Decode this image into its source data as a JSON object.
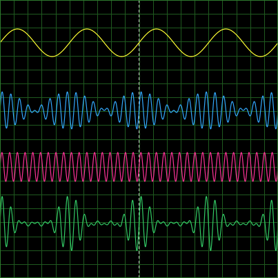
{
  "screen": {
    "background": "#000000",
    "grid_color": "#1f5a1f",
    "border_color": "#2e7a2e",
    "center_marker_color": "#bfbfbf",
    "major_divisions_x": 20,
    "major_divisions_y": 20,
    "center_marker": "dashed"
  },
  "chart_data": {
    "type": "line",
    "title": "",
    "xlabel": "",
    "ylabel": "",
    "grid": true,
    "legend": "none",
    "x_range": [
      0,
      1
    ],
    "traces": [
      {
        "id": "trace-1",
        "color": "#ffff33",
        "kind": "sine",
        "cycles": 4,
        "phase": 0.0,
        "amplitude": 1.0
      },
      {
        "id": "trace-2",
        "color": "#33aaff",
        "kind": "sum-of-sines",
        "components": [
          {
            "cycles": 30,
            "amplitude": 0.5
          },
          {
            "cycles": 34,
            "amplitude": 0.5
          }
        ]
      },
      {
        "id": "trace-3",
        "color": "#ff3399",
        "kind": "sum-of-sines",
        "components": [
          {
            "cycles": 36,
            "amplitude": 1.0
          }
        ]
      },
      {
        "id": "trace-4",
        "color": "#33cc66",
        "kind": "sum-of-sines",
        "components": [
          {
            "cycles": 30,
            "amplitude": 0.32
          },
          {
            "cycles": 34,
            "amplitude": 0.32
          },
          {
            "cycles": 26,
            "amplitude": 0.18
          },
          {
            "cycles": 38,
            "amplitude": 0.18
          }
        ]
      }
    ]
  }
}
